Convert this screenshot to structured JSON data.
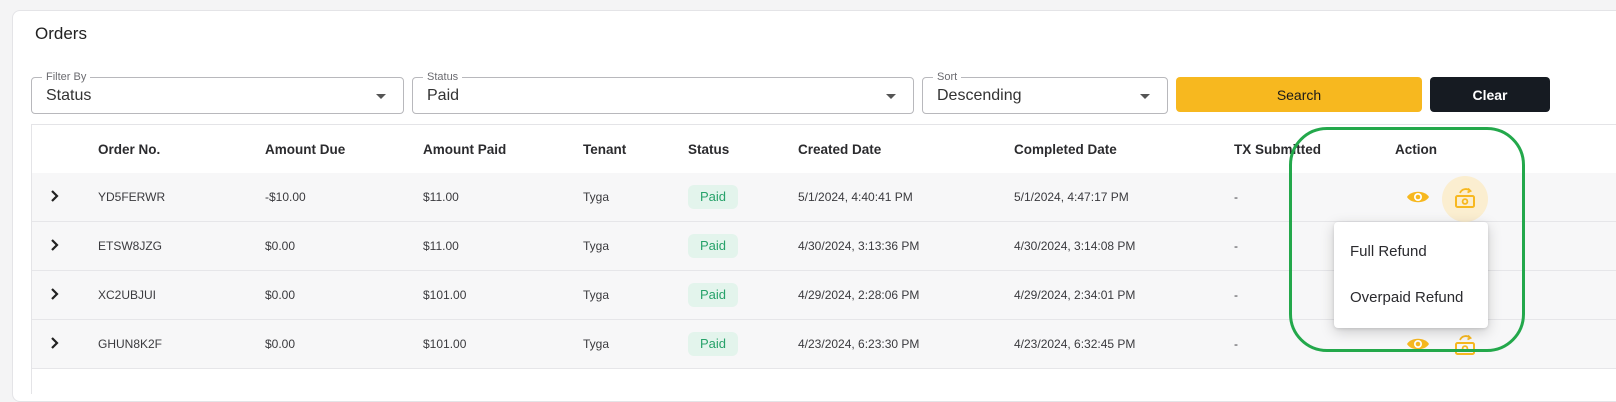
{
  "page": {
    "title": "Orders"
  },
  "filters": {
    "filter_by": {
      "legend": "Filter By",
      "value": "Status"
    },
    "status": {
      "legend": "Status",
      "value": "Paid"
    },
    "sort": {
      "legend": "Sort",
      "value": "Descending"
    }
  },
  "buttons": {
    "search": "Search",
    "clear": "Clear"
  },
  "table": {
    "columns": [
      "Order No.",
      "Amount Due",
      "Amount Paid",
      "Tenant",
      "Status",
      "Created Date",
      "Completed Date",
      "TX Submitted",
      "Action"
    ],
    "rows": [
      {
        "order_no": "YD5FERWR",
        "amount_due": "-$10.00",
        "amount_paid": "$11.00",
        "tenant": "Tyga",
        "status": "Paid",
        "created": "5/1/2024, 4:40:41 PM",
        "completed": "5/1/2024, 4:47:17 PM",
        "tx": "-"
      },
      {
        "order_no": "ETSW8JZG",
        "amount_due": "$0.00",
        "amount_paid": "$11.00",
        "tenant": "Tyga",
        "status": "Paid",
        "created": "4/30/2024, 3:13:36 PM",
        "completed": "4/30/2024, 3:14:08 PM",
        "tx": "-"
      },
      {
        "order_no": "XC2UBJUI",
        "amount_due": "$0.00",
        "amount_paid": "$101.00",
        "tenant": "Tyga",
        "status": "Paid",
        "created": "4/29/2024, 2:28:06 PM",
        "completed": "4/29/2024, 2:34:01 PM",
        "tx": "-"
      },
      {
        "order_no": "GHUN8K2F",
        "amount_due": "$0.00",
        "amount_paid": "$101.00",
        "tenant": "Tyga",
        "status": "Paid",
        "created": "4/23/2024, 6:23:30 PM",
        "completed": "4/23/2024, 6:32:45 PM",
        "tx": "-"
      }
    ]
  },
  "refund_menu": {
    "items": [
      "Full Refund",
      "Overpaid Refund"
    ]
  },
  "icons": {
    "expand": "chevron-right-icon",
    "view": "eye-icon",
    "refund": "refund-icon"
  },
  "colors": {
    "accent": "#f7b81f",
    "dark": "#161b22",
    "paid_bg": "#e3f4ec",
    "paid_text": "#27a26a",
    "highlight": "#23a84b"
  }
}
